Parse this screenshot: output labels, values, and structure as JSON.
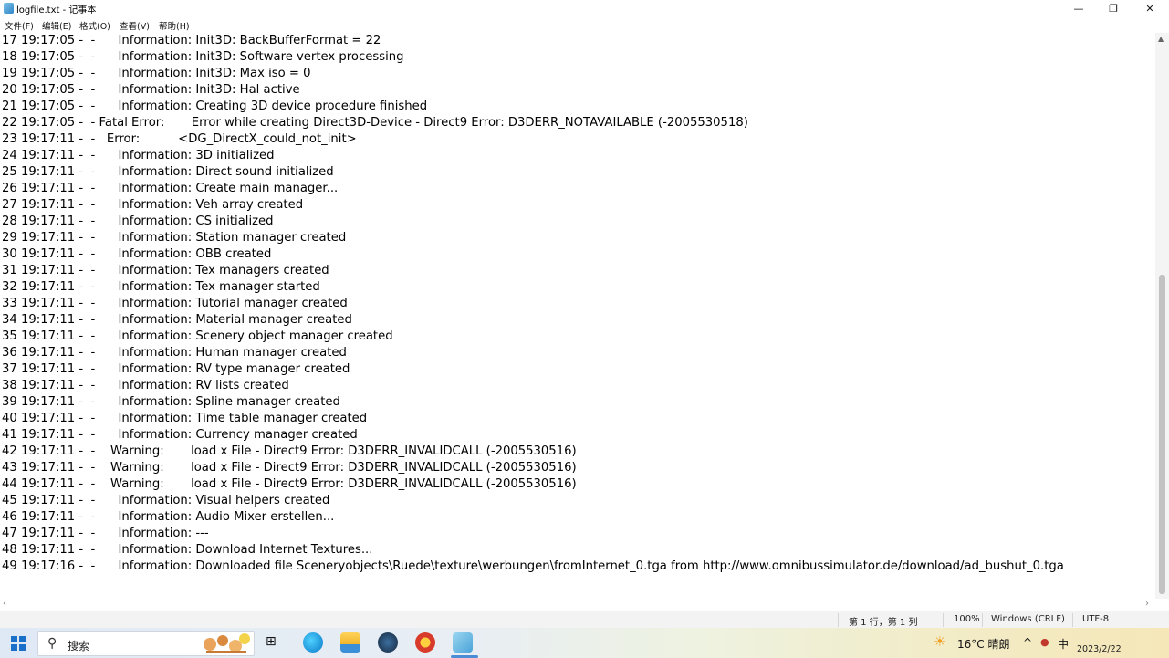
{
  "window": {
    "title": "logfile.txt - 记事本",
    "minimize_glyph": "—",
    "maximize_glyph": "❐",
    "close_glyph": "✕"
  },
  "menu": [
    "文件(F)",
    "编辑(E)",
    "格式(O)",
    "查看(V)",
    "帮助(H)"
  ],
  "log_lines": [
    "17 19:17:05 -  -      Information: Init3D: BackBufferFormat = 22",
    "18 19:17:05 -  -      Information: Init3D: Software vertex processing",
    "19 19:17:05 -  -      Information: Init3D: Max iso = 0",
    "20 19:17:05 -  -      Information: Init3D: Hal active",
    "21 19:17:05 -  -      Information: Creating 3D device procedure finished",
    "22 19:17:05 -  - Fatal Error:       Error while creating Direct3D-Device - Direct9 Error: D3DERR_NOTAVAILABLE (-2005530518)",
    "23 19:17:11 -  -   Error:          <DG_DirectX_could_not_init>",
    "24 19:17:11 -  -      Information: 3D initialized",
    "25 19:17:11 -  -      Information: Direct sound initialized",
    "26 19:17:11 -  -      Information: Create main manager...",
    "27 19:17:11 -  -      Information: Veh array created",
    "28 19:17:11 -  -      Information: CS initialized",
    "29 19:17:11 -  -      Information: Station manager created",
    "30 19:17:11 -  -      Information: OBB created",
    "31 19:17:11 -  -      Information: Tex managers created",
    "32 19:17:11 -  -      Information: Tex manager started",
    "33 19:17:11 -  -      Information: Tutorial manager created",
    "34 19:17:11 -  -      Information: Material manager created",
    "35 19:17:11 -  -      Information: Scenery object manager created",
    "36 19:17:11 -  -      Information: Human manager created",
    "37 19:17:11 -  -      Information: RV type manager created",
    "38 19:17:11 -  -      Information: RV lists created",
    "39 19:17:11 -  -      Information: Spline manager created",
    "40 19:17:11 -  -      Information: Time table manager created",
    "41 19:17:11 -  -      Information: Currency manager created",
    "42 19:17:11 -  -    Warning:       load x File - Direct9 Error: D3DERR_INVALIDCALL (-2005530516)",
    "43 19:17:11 -  -    Warning:       load x File - Direct9 Error: D3DERR_INVALIDCALL (-2005530516)",
    "44 19:17:11 -  -    Warning:       load x File - Direct9 Error: D3DERR_INVALIDCALL (-2005530516)",
    "45 19:17:11 -  -      Information: Visual helpers created",
    "46 19:17:11 -  -      Information: Audio Mixer erstellen...",
    "47 19:17:11 -  -      Information: ---",
    "48 19:17:11 -  -      Information: Download Internet Textures...",
    "49 19:17:16 -  -      Information: Downloaded file Sceneryobjects\\Ruede\\texture\\werbungen\\fromInternet_0.tga from http://www.omnibussimulator.de/download/ad_bushut_0.tga"
  ],
  "status": {
    "position": "第 1 行，第 1 列",
    "zoom": "100%",
    "line_ending": "Windows (CRLF)",
    "encoding": "UTF-8"
  },
  "taskbar": {
    "search_placeholder": "搜索",
    "task_view_glyph": "⊞",
    "apps": [
      "edge-icon",
      "file-explorer-icon",
      "steam-icon",
      "game-icon",
      "notepad-icon"
    ],
    "weather": "16°C  晴朗",
    "ime": "中",
    "chevron": "^",
    "date": "2023/2/22"
  },
  "colors": {
    "accent": "#1a6fc9",
    "status_bg": "#f3f3f3"
  }
}
